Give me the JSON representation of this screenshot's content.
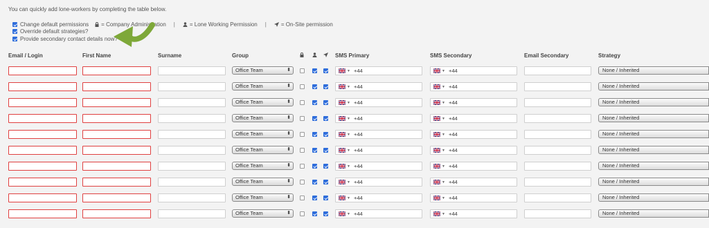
{
  "intro": "You can quickly add lone-workers by completing the table below.",
  "options": {
    "change_permissions": {
      "label": "Change default permissions",
      "checked": true
    },
    "override_strategies": {
      "label": "Override default strategies?",
      "checked": true
    },
    "secondary_contact": {
      "label": "Provide secondary contact details now?",
      "checked": true
    }
  },
  "legend": {
    "admin": "= Company Administration",
    "separator": "|",
    "lone": "= Lone Working Permission",
    "onsite": "= On-Site permission"
  },
  "icons": {
    "admin": "lock-icon",
    "lone": "person-icon",
    "onsite": "location-arrow-icon",
    "flag": "uk-flag-icon"
  },
  "columns": {
    "email": "Email / Login",
    "first_name": "First Name",
    "surname": "Surname",
    "group": "Group",
    "sms_primary": "SMS Primary",
    "sms_secondary": "SMS Secondary",
    "email_secondary": "Email Secondary",
    "strategy": "Strategy"
  },
  "colors": {
    "error_border": "#e04040",
    "checkbox": "#2e6ddb",
    "arrow": "#7ea839"
  },
  "rows": [
    {
      "group": "Office Team",
      "admin": false,
      "lone": true,
      "onsite": true,
      "sms_primary": "+44",
      "sms_secondary": "+44",
      "strategy": "None / Inherited"
    },
    {
      "group": "Office Team",
      "admin": false,
      "lone": true,
      "onsite": true,
      "sms_primary": "+44",
      "sms_secondary": "+44",
      "strategy": "None / Inherited"
    },
    {
      "group": "Office Team",
      "admin": false,
      "lone": true,
      "onsite": true,
      "sms_primary": "+44",
      "sms_secondary": "+44",
      "strategy": "None / Inherited"
    },
    {
      "group": "Office Team",
      "admin": false,
      "lone": true,
      "onsite": true,
      "sms_primary": "+44",
      "sms_secondary": "+44",
      "strategy": "None / Inherited"
    },
    {
      "group": "Office Team",
      "admin": false,
      "lone": true,
      "onsite": true,
      "sms_primary": "+44",
      "sms_secondary": "+44",
      "strategy": "None / Inherited"
    },
    {
      "group": "Office Team",
      "admin": false,
      "lone": true,
      "onsite": true,
      "sms_primary": "+44",
      "sms_secondary": "+44",
      "strategy": "None / Inherited"
    },
    {
      "group": "Office Team",
      "admin": false,
      "lone": true,
      "onsite": true,
      "sms_primary": "+44",
      "sms_secondary": "+44",
      "strategy": "None / Inherited"
    },
    {
      "group": "Office Team",
      "admin": false,
      "lone": true,
      "onsite": true,
      "sms_primary": "+44",
      "sms_secondary": "+44",
      "strategy": "None / Inherited"
    },
    {
      "group": "Office Team",
      "admin": false,
      "lone": true,
      "onsite": true,
      "sms_primary": "+44",
      "sms_secondary": "+44",
      "strategy": "None / Inherited"
    },
    {
      "group": "Office Team",
      "admin": false,
      "lone": true,
      "onsite": true,
      "sms_primary": "+44",
      "sms_secondary": "+44",
      "strategy": "None / Inherited"
    }
  ]
}
